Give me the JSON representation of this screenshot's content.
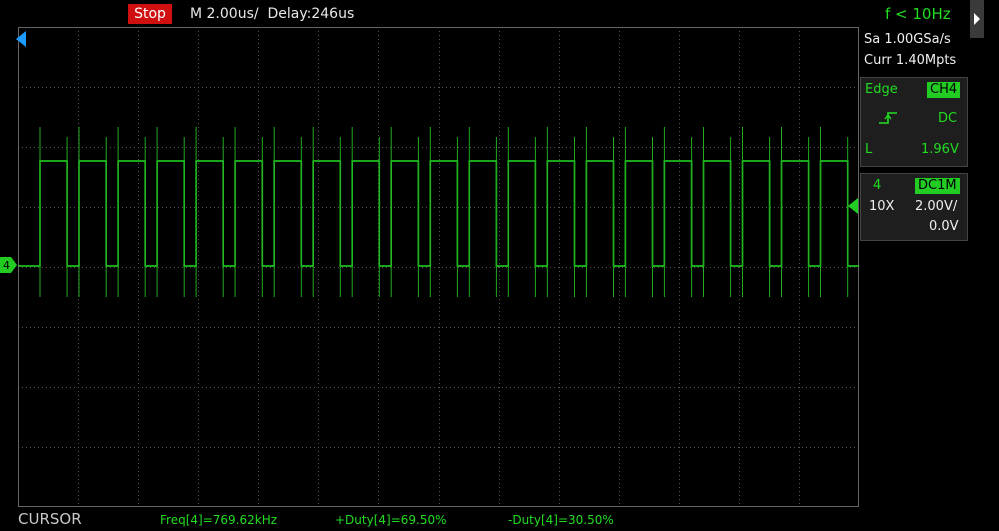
{
  "status": {
    "stop_label": "Stop",
    "timebase": "M 2.00us/",
    "delay": "Delay:246us",
    "freq_indicator": "f < 10Hz"
  },
  "acquire": {
    "sample_rate": "Sa 1.00GSa/s",
    "memory": "Curr 1.40Mpts"
  },
  "trigger": {
    "mode": "Edge",
    "source": "CH4",
    "coupling": "DC",
    "level_label": "L",
    "level": "1.96V"
  },
  "channel": {
    "number": "4",
    "coupling": "DC1M",
    "probe": "10X",
    "scale": "2.00V/",
    "offset": "0.0V"
  },
  "ground_marker": "4",
  "bottom": {
    "cursor_label": "CURSOR",
    "freq": "Freq[4]=769.62kHz",
    "pos_duty": "+Duty[4]=69.50%",
    "neg_duty": "-Duty[4]=30.50%"
  },
  "colors": {
    "trace": "#22dd22",
    "stop": "#d01010",
    "grid": "#5a5a5a"
  }
}
